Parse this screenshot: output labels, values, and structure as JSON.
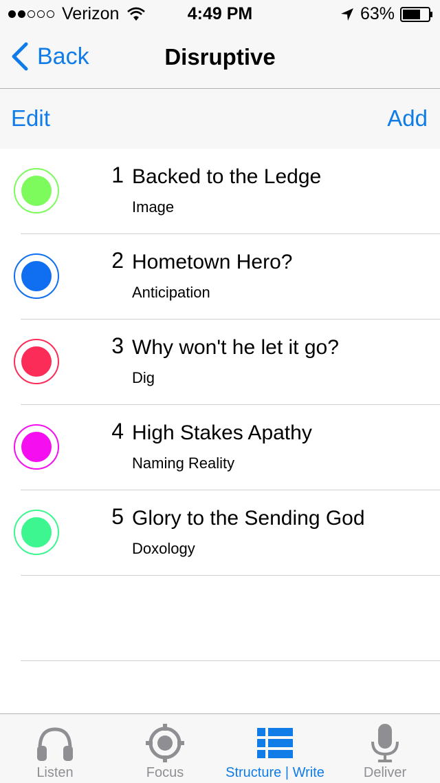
{
  "status_bar": {
    "carrier": "Verizon",
    "time": "4:49 PM",
    "battery": "63%",
    "signal_bars_full": 2,
    "signal_bars_total": 5
  },
  "nav": {
    "back_label": "Back",
    "title": "Disruptive"
  },
  "toolbar": {
    "edit_label": "Edit",
    "add_label": "Add"
  },
  "items": [
    {
      "number": "1",
      "title": "Backed to the Ledge",
      "subtitle": "Image",
      "color": "#7dfa5c"
    },
    {
      "number": "2",
      "title": "Hometown Hero?",
      "subtitle": "Anticipation",
      "color": "#0f6ff0"
    },
    {
      "number": "3",
      "title": "Why won't he let it go?",
      "subtitle": "Dig",
      "color": "#fb2c58"
    },
    {
      "number": "4",
      "title": "High Stakes Apathy",
      "subtitle": "Naming Reality",
      "color": "#f50ff0"
    },
    {
      "number": "5",
      "title": "Glory to the Sending God",
      "subtitle": "Doxology",
      "color": "#3df68f"
    }
  ],
  "tabs": [
    {
      "label": "Listen",
      "icon": "headphones-icon",
      "active": false
    },
    {
      "label": "Focus",
      "icon": "crosshair-icon",
      "active": false
    },
    {
      "label": "Structure | Write",
      "icon": "list-icon",
      "active": true
    },
    {
      "label": "Deliver",
      "icon": "microphone-icon",
      "active": false
    }
  ],
  "colors": {
    "accent": "#0f7ce8",
    "inactive": "#8e8e93"
  }
}
